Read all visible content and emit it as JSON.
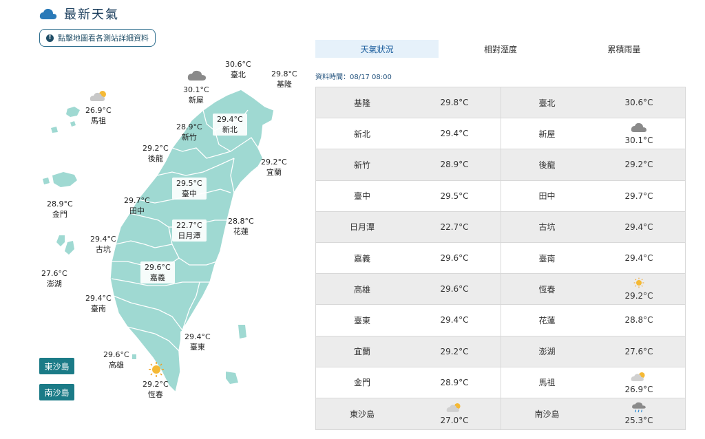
{
  "header": {
    "title": "最新天氣"
  },
  "hint": {
    "icon": "info-icon",
    "label": "點擊地圖看各測站詳細資料"
  },
  "map": {
    "stations": {
      "keelung": {
        "temp": "29.8°C",
        "name": "基隆"
      },
      "taipei": {
        "temp": "30.6°C",
        "name": "臺北"
      },
      "xinwu": {
        "temp": "30.1°C",
        "name": "新屋"
      },
      "newtaipei": {
        "temp": "29.4°C",
        "name": "新北"
      },
      "hsinchu": {
        "temp": "28.9°C",
        "name": "新竹"
      },
      "houlong": {
        "temp": "29.2°C",
        "name": "後龍"
      },
      "yilan": {
        "temp": "29.2°C",
        "name": "宜蘭"
      },
      "taichung": {
        "temp": "29.5°C",
        "name": "臺中"
      },
      "tianzhong": {
        "temp": "29.7°C",
        "name": "田中"
      },
      "sunmoonlake": {
        "temp": "22.7°C",
        "name": "日月潭"
      },
      "hualien": {
        "temp": "28.8°C",
        "name": "花蓮"
      },
      "gukeng": {
        "temp": "29.4°C",
        "name": "古坑"
      },
      "chiayi": {
        "temp": "29.6°C",
        "name": "嘉義"
      },
      "tainan": {
        "temp": "29.4°C",
        "name": "臺南"
      },
      "taitung": {
        "temp": "29.4°C",
        "name": "臺東"
      },
      "kaohsiung": {
        "temp": "29.6°C",
        "name": "高雄"
      },
      "hengchun": {
        "temp": "29.2°C",
        "name": "恆春"
      },
      "matsu": {
        "temp": "26.9°C",
        "name": "馬祖"
      },
      "kinmen": {
        "temp": "28.9°C",
        "name": "金門"
      },
      "penghu": {
        "temp": "27.6°C",
        "name": "澎湖"
      }
    },
    "buttons": {
      "dongsha": "東沙島",
      "nansha": "南沙島"
    }
  },
  "tabs": [
    "天氣狀況",
    "相對溼度",
    "累積雨量"
  ],
  "data_time": "資料時間：08/17 08:00",
  "table": [
    {
      "n1": "基隆",
      "v1": "29.8°C",
      "i1": "",
      "n2": "臺北",
      "v2": "30.6°C",
      "i2": ""
    },
    {
      "n1": "新北",
      "v1": "29.4°C",
      "i1": "",
      "n2": "新屋",
      "v2": "30.1°C",
      "i2": "cloud-icon"
    },
    {
      "n1": "新竹",
      "v1": "28.9°C",
      "i1": "",
      "n2": "後龍",
      "v2": "29.2°C",
      "i2": ""
    },
    {
      "n1": "臺中",
      "v1": "29.5°C",
      "i1": "",
      "n2": "田中",
      "v2": "29.7°C",
      "i2": ""
    },
    {
      "n1": "日月潭",
      "v1": "22.7°C",
      "i1": "",
      "n2": "古坑",
      "v2": "29.4°C",
      "i2": ""
    },
    {
      "n1": "嘉義",
      "v1": "29.6°C",
      "i1": "",
      "n2": "臺南",
      "v2": "29.4°C",
      "i2": ""
    },
    {
      "n1": "高雄",
      "v1": "29.6°C",
      "i1": "",
      "n2": "恆春",
      "v2": "29.2°C",
      "i2": "sun-icon"
    },
    {
      "n1": "臺東",
      "v1": "29.4°C",
      "i1": "",
      "n2": "花蓮",
      "v2": "28.8°C",
      "i2": ""
    },
    {
      "n1": "宜蘭",
      "v1": "29.2°C",
      "i1": "",
      "n2": "澎湖",
      "v2": "27.6°C",
      "i2": ""
    },
    {
      "n1": "金門",
      "v1": "28.9°C",
      "i1": "",
      "n2": "馬祖",
      "v2": "26.9°C",
      "i2": "partly-cloudy-icon"
    },
    {
      "n1": "東沙島",
      "v1": "27.0°C",
      "i1": "partly-cloudy-icon",
      "n2": "南沙島",
      "v2": "25.3°C",
      "i2": "rain-cloud-icon"
    }
  ],
  "colors": {
    "map_fill": "#9fd9d2",
    "accent": "#1b7b87",
    "tab_active": "#e6f1fa"
  }
}
